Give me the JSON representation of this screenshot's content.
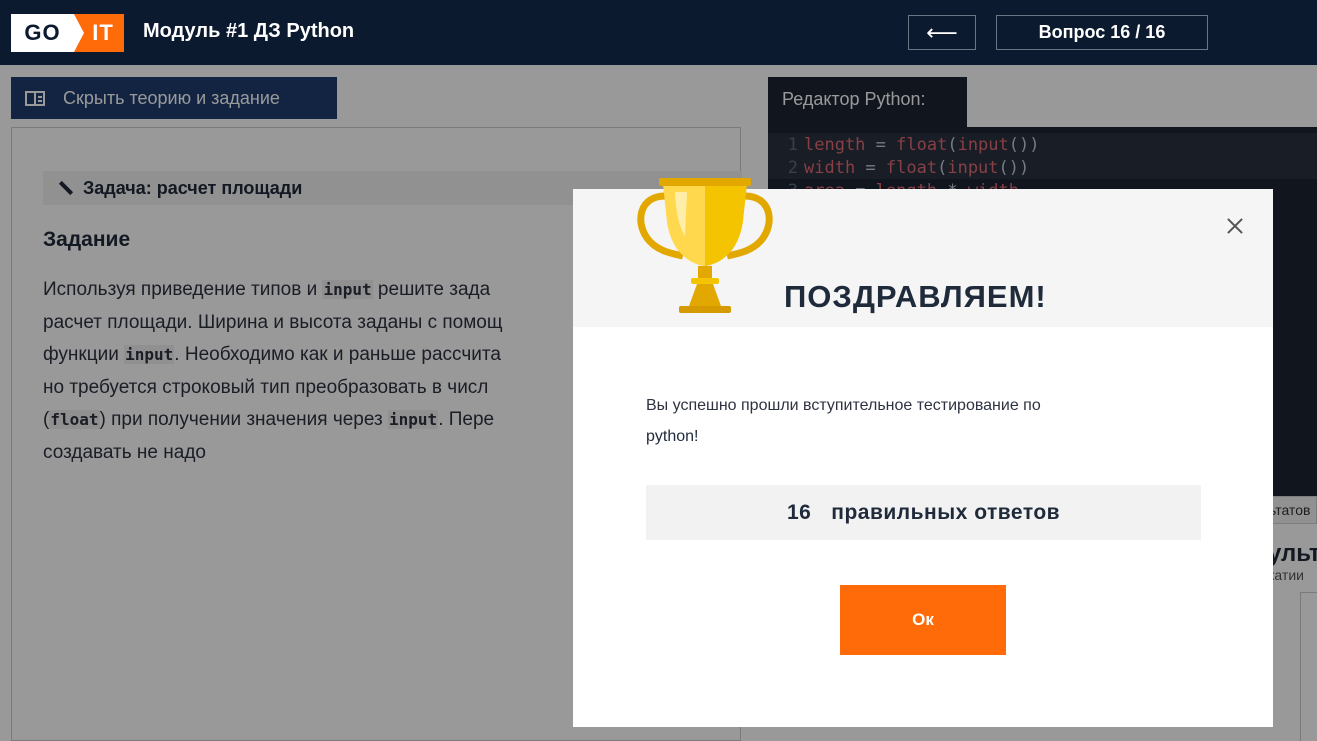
{
  "header": {
    "logo_go": "GO",
    "logo_it": "IT",
    "title": "Модуль #1 ДЗ Python",
    "back_icon": "⟵",
    "question_counter": "Вопрос 16 / 16"
  },
  "left": {
    "hide_button_label": "Скрыть теорию и задание",
    "task_bar_label": "Задача: расчет площади",
    "heading": "Задание",
    "text_parts": [
      "Используя приведение типов и ",
      "input",
      " решите зада",
      "расчет площади. Ширина и высота заданы с помощ",
      "функции ",
      "input",
      ". Необходимо как и раньше рассчита",
      "но требуется строковый тип преобразовать в числ",
      "(",
      "float",
      ") при получении значения через ",
      "input",
      ". Пере",
      "создавать не надо"
    ]
  },
  "editor": {
    "tab_label": "Редактор Python:",
    "lines": [
      {
        "num": "1",
        "var": "length",
        "op": " = ",
        "fn": "float",
        "p1": "(",
        "fn2": "input",
        "p2": "())"
      },
      {
        "num": "2",
        "var": "width",
        "op": " = ",
        "fn": "float",
        "p1": "(",
        "fn2": "input",
        "p2": "())"
      },
      {
        "num": "3",
        "var": "area",
        "op": " = ",
        "fn": "length",
        "p1": " * ",
        "fn2": "width",
        "p2": ""
      }
    ]
  },
  "results": {
    "tab_partial": "ьтатов",
    "title_partial": "ульт",
    "sub_partial": "катии"
  },
  "modal": {
    "title": "ПОЗДРАВЛЯЕМ!",
    "message": "Вы успешно прошли вступительное тестирование по",
    "message_bold": "python!",
    "score_number": "16",
    "score_label": "правильных ответов",
    "ok_label": "Ок",
    "colors": {
      "accent": "#ff6b08",
      "header": "#0b1a2f",
      "trophy": "#f5c400"
    }
  }
}
